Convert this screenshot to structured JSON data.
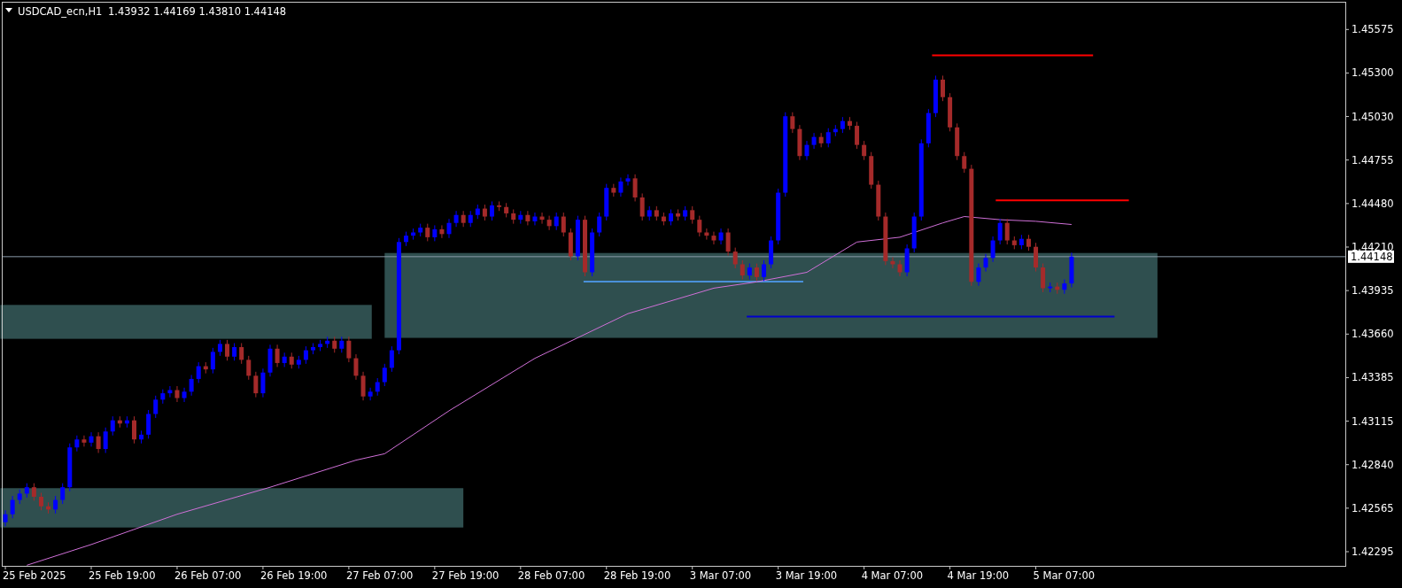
{
  "header": {
    "symbol": "USDCAD_ecn,H1",
    "ohlc": "1.43932 1.44169 1.43810 1.44148"
  },
  "price_axis": {
    "labels": [
      "1.45575",
      "1.45300",
      "1.45030",
      "1.44755",
      "1.44480",
      "1.44210",
      "1.43935",
      "1.43660",
      "1.43385",
      "1.43115",
      "1.42840",
      "1.42565",
      "1.42295"
    ],
    "current_price": "1.44148"
  },
  "time_axis": {
    "labels": [
      "25 Feb 2025",
      "25 Feb 19:00",
      "26 Feb 07:00",
      "26 Feb 19:00",
      "27 Feb 07:00",
      "27 Feb 19:00",
      "28 Feb 07:00",
      "28 Feb 19:00",
      "3 Mar 07:00",
      "3 Mar 19:00",
      "4 Mar 07:00",
      "4 Mar 19:00",
      "5 Mar 07:00"
    ]
  }
}
